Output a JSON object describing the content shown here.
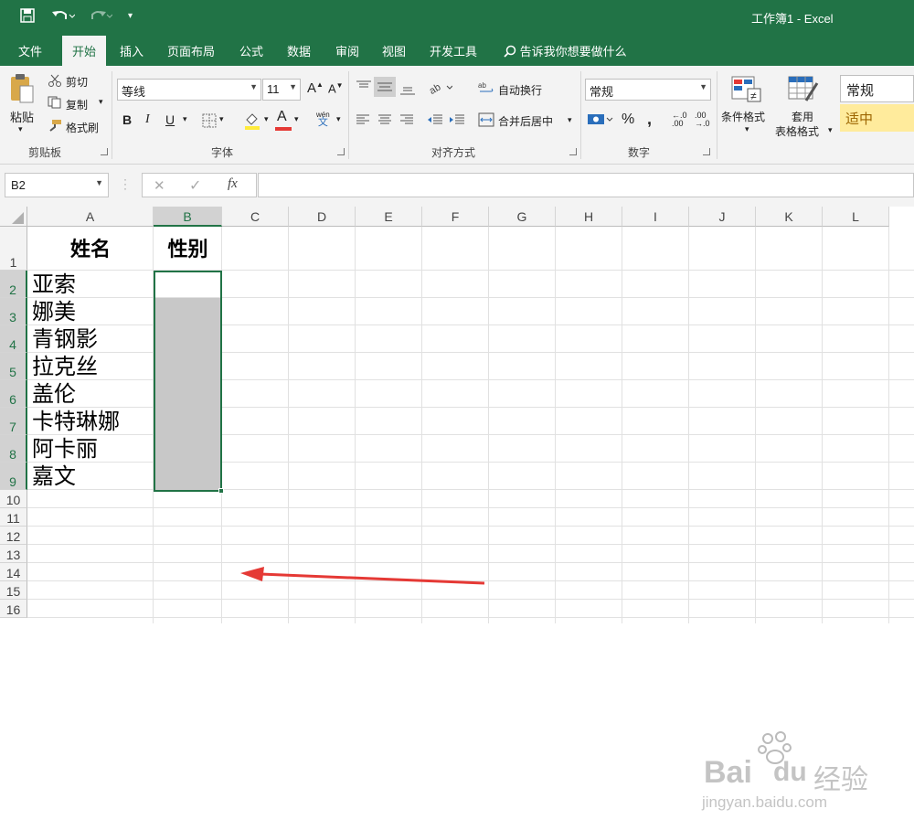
{
  "window": {
    "title": "工作簿1  -  Excel"
  },
  "tabs": [
    "文件",
    "开始",
    "插入",
    "页面布局",
    "公式",
    "数据",
    "审阅",
    "视图",
    "开发工具"
  ],
  "active_tab": "开始",
  "tell_me": "告诉我你想要做什么",
  "clipboard": {
    "paste": "粘贴",
    "cut": "剪切",
    "copy": "复制",
    "format_painter": "格式刷",
    "group": "剪贴板"
  },
  "font": {
    "name": "等线",
    "size": "11",
    "group": "字体",
    "grow": "A",
    "shrink": "A",
    "bold": "B",
    "italic": "I",
    "underline": "U",
    "font_color_letter": "A",
    "phonetic": "wén"
  },
  "alignment": {
    "wrap": "自动换行",
    "merge": "合并后居中",
    "group": "对齐方式"
  },
  "number": {
    "format": "常规",
    "percent": "%",
    "comma": ",",
    "inc_decimal": "←.0\n.00",
    "dec_decimal": ".00\n→.0",
    "group": "数字"
  },
  "styles": {
    "conditional": "条件格式",
    "table_format_line1": "套用",
    "table_format_line2": "表格格式",
    "normal": "常规",
    "neutral": "适中"
  },
  "formula_bar": {
    "name_box": "B2",
    "fx": "fx",
    "content": ""
  },
  "columns": [
    "A",
    "B",
    "C",
    "D",
    "E",
    "F",
    "G",
    "H",
    "I",
    "J",
    "K",
    "L"
  ],
  "rows": [
    "1",
    "2",
    "3",
    "4",
    "5",
    "6",
    "7",
    "8",
    "9",
    "10",
    "11",
    "12",
    "13",
    "14",
    "15",
    "16"
  ],
  "selected_column": "B",
  "sheet": {
    "header_A": "姓名",
    "header_B": "性别",
    "names": [
      "亚索",
      "娜美",
      "青钢影",
      "拉克丝",
      "盖伦",
      "卡特琳娜",
      "阿卡丽",
      "嘉文"
    ]
  },
  "watermark": {
    "brand": "Bai",
    "brand2": "du",
    "cn": "经验",
    "url": "jingyan.baidu.com"
  },
  "colors": {
    "excel_green": "#217346",
    "selection_fill": "#c8c8c8",
    "arrow": "#e53935",
    "neutral_bg": "#ffeb9c"
  }
}
